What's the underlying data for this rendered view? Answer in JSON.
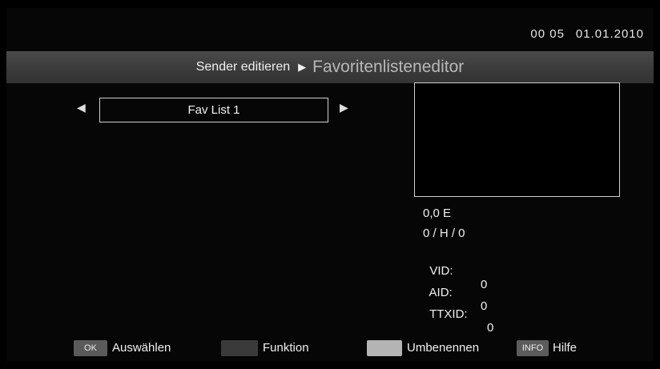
{
  "status": {
    "time": "00 05",
    "date": "01.01.2010"
  },
  "breadcrumb": {
    "parent": "Sender editieren",
    "current": "Favoritenlisteneditor"
  },
  "fav_list": {
    "selected": "Fav List 1"
  },
  "channel_info": {
    "position": "0,0 E",
    "tp": "0 / H / 0",
    "vid_label": "VID:",
    "vid_value": "0",
    "aid_label": "AID:",
    "aid_value": "0",
    "ttxid_label": "TTXID:",
    "ttxid_value": "0"
  },
  "footer": {
    "ok_key": "OK",
    "ok_label": "Auswählen",
    "red_label": "Funktion",
    "yellow_label": "Umbenennen",
    "info_key": "INFO",
    "info_label": "Hilfe"
  },
  "colors": {
    "red_key": "#3a3a3a",
    "yellow_key": "#b4b4b4",
    "ok_key": "#5a5a5a",
    "info_key": "#5c5c5c"
  }
}
